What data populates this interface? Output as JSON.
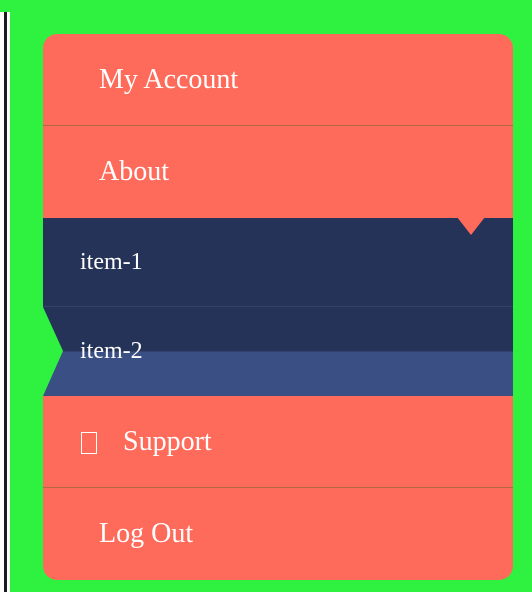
{
  "menu": {
    "items": [
      {
        "label": "My Account"
      },
      {
        "label": "About"
      },
      {
        "label": "Support",
        "icon": "missing-glyph-icon"
      },
      {
        "label": "Log Out"
      }
    ],
    "submenu": {
      "items": [
        {
          "label": "item-1"
        },
        {
          "label": "item-2"
        }
      ]
    }
  },
  "colors": {
    "background": "#2ef23f",
    "menu": "#ff6b5a",
    "submenu": "#253358",
    "submenu_active": "#3a4f84",
    "text": "#ffffff"
  }
}
